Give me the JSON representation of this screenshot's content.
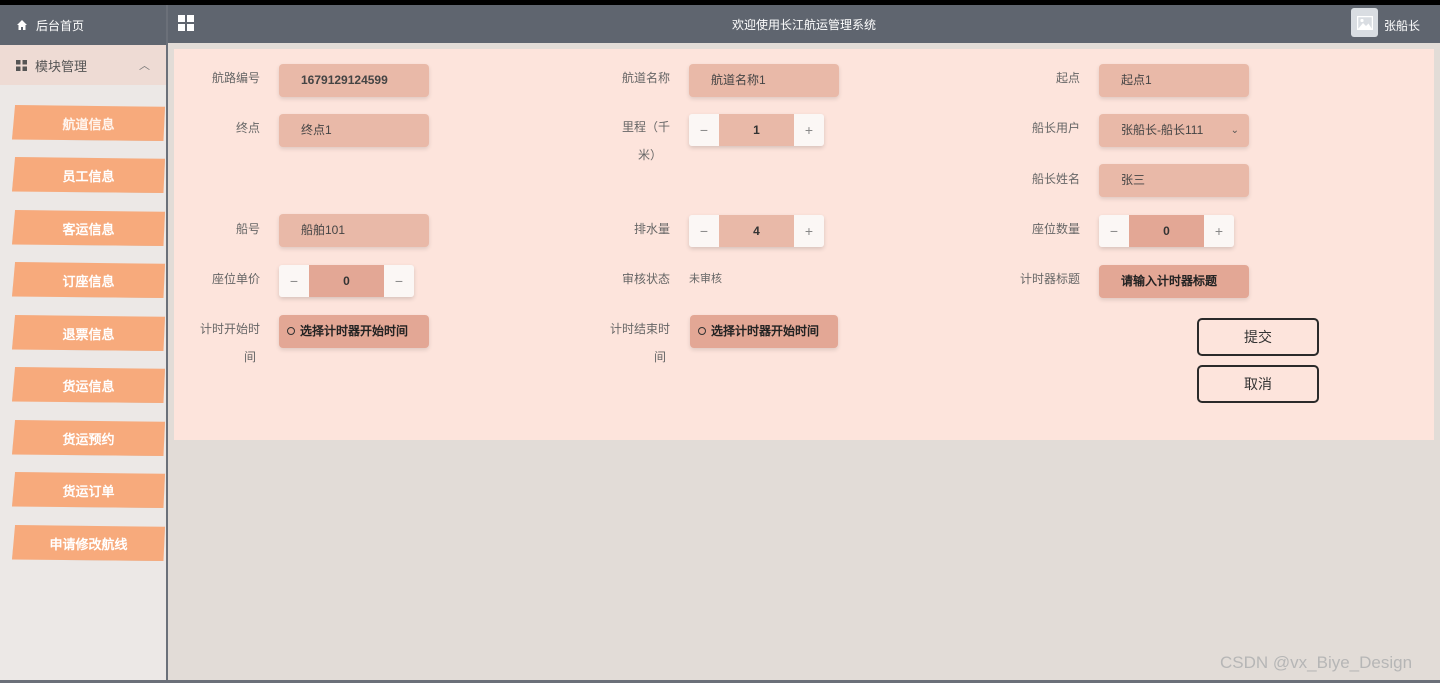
{
  "header": {
    "system_title": "欢迎使用长江航运管理系统",
    "username": "张船长",
    "grid_icon": "grid-icon",
    "avatar_icon": "image-icon"
  },
  "sidebar": {
    "home_label": "后台首页",
    "module_label": "模块管理",
    "items": [
      {
        "label": "航道信息"
      },
      {
        "label": "员工信息"
      },
      {
        "label": "客运信息"
      },
      {
        "label": "订座信息"
      },
      {
        "label": "退票信息"
      },
      {
        "label": "货运信息"
      },
      {
        "label": "货运预约"
      },
      {
        "label": "货运订单"
      },
      {
        "label": "申请修改航线"
      }
    ]
  },
  "form": {
    "route_no_label": "航路编号",
    "route_no_value": "1679129124599",
    "channel_name_label": "航道名称",
    "channel_name_value": "航道名称1",
    "start_label": "起点",
    "start_value": "起点1",
    "end_label": "终点",
    "end_value": "终点1",
    "distance_label_line1": "里程（千",
    "distance_label_line2": "米）",
    "distance_value": "1",
    "captain_account_label": "船长用户",
    "captain_account_value": "张船长-船长111",
    "captain_name_label": "船长姓名",
    "captain_name_value": "张三",
    "ship_no_label": "船号",
    "ship_no_value": "船舶101",
    "displacement_label": "排水量",
    "displacement_value": "4",
    "seat_count_label": "座位数量",
    "seat_count_value": "0",
    "seat_price_label": "座位单价",
    "seat_price_value": "0",
    "review_status_label": "审核状态",
    "review_status_value": "未审核",
    "timer_title_label": "计时器标题",
    "timer_title_placeholder": "请输入计时器标题",
    "timer_start_label_line1": "计时开始时",
    "timer_start_label_line2": "间",
    "timer_start_placeholder": "选择计时器开始时间",
    "timer_end_label_line1": "计时结束时",
    "timer_end_label_line2": "间",
    "timer_end_placeholder": "选择计时器开始时间",
    "submit_label": "提交",
    "cancel_label": "取消",
    "stepper_minus": "−",
    "stepper_plus": "+"
  },
  "watermark": "CSDN @vx_Biye_Design",
  "colors": {
    "header_bg": "#5f656f",
    "sidebar_item": "#f7aa7c",
    "panel_bg": "#fde4dc",
    "input_bg": "#e9b9a8"
  }
}
